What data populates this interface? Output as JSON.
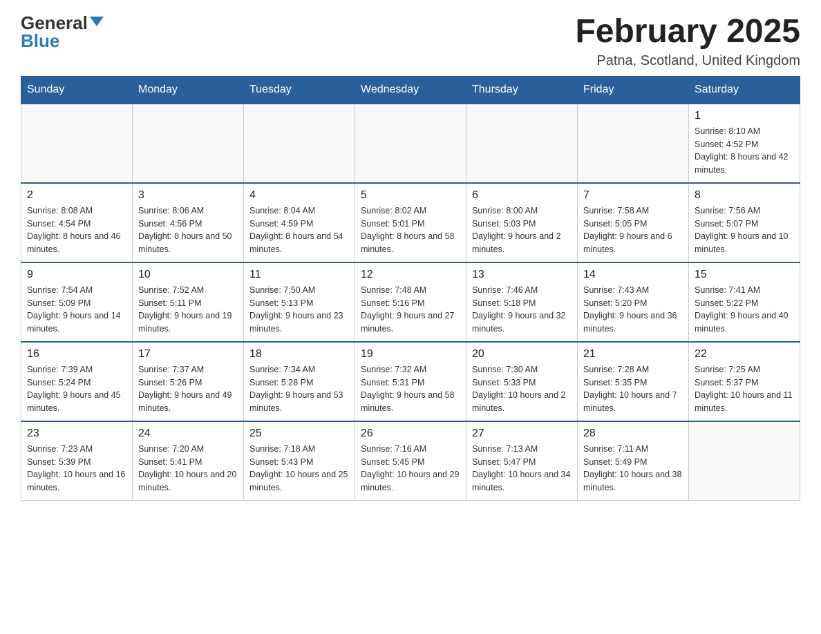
{
  "logo": {
    "general": "General",
    "blue": "Blue"
  },
  "title": "February 2025",
  "location": "Patna, Scotland, United Kingdom",
  "weekdays": [
    "Sunday",
    "Monday",
    "Tuesday",
    "Wednesday",
    "Thursday",
    "Friday",
    "Saturday"
  ],
  "weeks": [
    [
      {
        "day": "",
        "info": ""
      },
      {
        "day": "",
        "info": ""
      },
      {
        "day": "",
        "info": ""
      },
      {
        "day": "",
        "info": ""
      },
      {
        "day": "",
        "info": ""
      },
      {
        "day": "",
        "info": ""
      },
      {
        "day": "1",
        "info": "Sunrise: 8:10 AM\nSunset: 4:52 PM\nDaylight: 8 hours and 42 minutes."
      }
    ],
    [
      {
        "day": "2",
        "info": "Sunrise: 8:08 AM\nSunset: 4:54 PM\nDaylight: 8 hours and 46 minutes."
      },
      {
        "day": "3",
        "info": "Sunrise: 8:06 AM\nSunset: 4:56 PM\nDaylight: 8 hours and 50 minutes."
      },
      {
        "day": "4",
        "info": "Sunrise: 8:04 AM\nSunset: 4:59 PM\nDaylight: 8 hours and 54 minutes."
      },
      {
        "day": "5",
        "info": "Sunrise: 8:02 AM\nSunset: 5:01 PM\nDaylight: 8 hours and 58 minutes."
      },
      {
        "day": "6",
        "info": "Sunrise: 8:00 AM\nSunset: 5:03 PM\nDaylight: 9 hours and 2 minutes."
      },
      {
        "day": "7",
        "info": "Sunrise: 7:58 AM\nSunset: 5:05 PM\nDaylight: 9 hours and 6 minutes."
      },
      {
        "day": "8",
        "info": "Sunrise: 7:56 AM\nSunset: 5:07 PM\nDaylight: 9 hours and 10 minutes."
      }
    ],
    [
      {
        "day": "9",
        "info": "Sunrise: 7:54 AM\nSunset: 5:09 PM\nDaylight: 9 hours and 14 minutes."
      },
      {
        "day": "10",
        "info": "Sunrise: 7:52 AM\nSunset: 5:11 PM\nDaylight: 9 hours and 19 minutes."
      },
      {
        "day": "11",
        "info": "Sunrise: 7:50 AM\nSunset: 5:13 PM\nDaylight: 9 hours and 23 minutes."
      },
      {
        "day": "12",
        "info": "Sunrise: 7:48 AM\nSunset: 5:16 PM\nDaylight: 9 hours and 27 minutes."
      },
      {
        "day": "13",
        "info": "Sunrise: 7:46 AM\nSunset: 5:18 PM\nDaylight: 9 hours and 32 minutes."
      },
      {
        "day": "14",
        "info": "Sunrise: 7:43 AM\nSunset: 5:20 PM\nDaylight: 9 hours and 36 minutes."
      },
      {
        "day": "15",
        "info": "Sunrise: 7:41 AM\nSunset: 5:22 PM\nDaylight: 9 hours and 40 minutes."
      }
    ],
    [
      {
        "day": "16",
        "info": "Sunrise: 7:39 AM\nSunset: 5:24 PM\nDaylight: 9 hours and 45 minutes."
      },
      {
        "day": "17",
        "info": "Sunrise: 7:37 AM\nSunset: 5:26 PM\nDaylight: 9 hours and 49 minutes."
      },
      {
        "day": "18",
        "info": "Sunrise: 7:34 AM\nSunset: 5:28 PM\nDaylight: 9 hours and 53 minutes."
      },
      {
        "day": "19",
        "info": "Sunrise: 7:32 AM\nSunset: 5:31 PM\nDaylight: 9 hours and 58 minutes."
      },
      {
        "day": "20",
        "info": "Sunrise: 7:30 AM\nSunset: 5:33 PM\nDaylight: 10 hours and 2 minutes."
      },
      {
        "day": "21",
        "info": "Sunrise: 7:28 AM\nSunset: 5:35 PM\nDaylight: 10 hours and 7 minutes."
      },
      {
        "day": "22",
        "info": "Sunrise: 7:25 AM\nSunset: 5:37 PM\nDaylight: 10 hours and 11 minutes."
      }
    ],
    [
      {
        "day": "23",
        "info": "Sunrise: 7:23 AM\nSunset: 5:39 PM\nDaylight: 10 hours and 16 minutes."
      },
      {
        "day": "24",
        "info": "Sunrise: 7:20 AM\nSunset: 5:41 PM\nDaylight: 10 hours and 20 minutes."
      },
      {
        "day": "25",
        "info": "Sunrise: 7:18 AM\nSunset: 5:43 PM\nDaylight: 10 hours and 25 minutes."
      },
      {
        "day": "26",
        "info": "Sunrise: 7:16 AM\nSunset: 5:45 PM\nDaylight: 10 hours and 29 minutes."
      },
      {
        "day": "27",
        "info": "Sunrise: 7:13 AM\nSunset: 5:47 PM\nDaylight: 10 hours and 34 minutes."
      },
      {
        "day": "28",
        "info": "Sunrise: 7:11 AM\nSunset: 5:49 PM\nDaylight: 10 hours and 38 minutes."
      },
      {
        "day": "",
        "info": ""
      }
    ]
  ]
}
